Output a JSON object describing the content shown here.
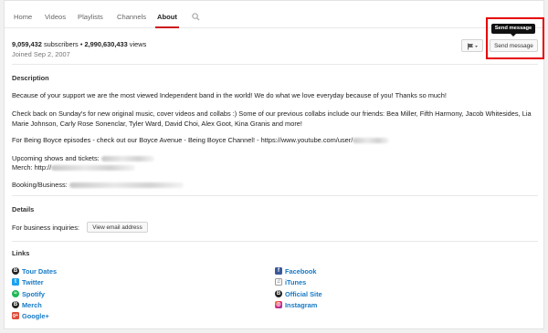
{
  "tabs": [
    {
      "label": "Home"
    },
    {
      "label": "Videos"
    },
    {
      "label": "Playlists"
    },
    {
      "label": "Channels"
    },
    {
      "label": "About"
    }
  ],
  "active_tab": "About",
  "stats": {
    "subscribers": "9,059,432",
    "subscribers_suffix": "subscribers",
    "separator": "•",
    "views": "2,990,630,433",
    "views_suffix": "views",
    "joined": "Joined Sep 2, 2007"
  },
  "actions": {
    "send_message_label": "Send message",
    "tooltip": "Send message"
  },
  "description": {
    "title": "Description",
    "p1": "Because of your support we are the most viewed Independent band in the world! We do what we love everyday because of you! Thanks so much!",
    "p2": "Check back on Sunday's for new original music, cover videos and collabs :) Some of our previous collabs include our friends: Bea Miller, Fifth Harmony, Jacob Whitesides, Lia Marie Johnson, Carly Rose Sonenclar, Tyler Ward, David Choi, Alex Goot, Kina Granis and more!",
    "p3": "For Being Boyce episodes - check out our Boyce Avenue - Being Boyce Channel! - https://www.youtube.com/user/",
    "p4a": "Upcoming shows and tickets: ",
    "p4b": "Merch: http://",
    "p5": "Booking/Business: "
  },
  "details": {
    "title": "Details",
    "business_label": "For business inquiries:",
    "email_button": "View email address"
  },
  "links": {
    "title": "Links",
    "left": [
      {
        "label": "Tour Dates",
        "icon": "channel-logo-icon",
        "color": "#222222"
      },
      {
        "label": "Twitter",
        "icon": "twitter-icon",
        "color": "#1da1f2"
      },
      {
        "label": "Spotify",
        "icon": "spotify-icon",
        "color": "#1db954"
      },
      {
        "label": "Merch",
        "icon": "channel-logo-icon",
        "color": "#222222"
      },
      {
        "label": "Google+",
        "icon": "google-plus-icon",
        "color": "#dd4b39"
      }
    ],
    "right": [
      {
        "label": "Facebook",
        "icon": "facebook-icon",
        "color": "#3b5998"
      },
      {
        "label": "iTunes",
        "icon": "itunes-icon",
        "color": "#8e8e8e"
      },
      {
        "label": "Official Site",
        "icon": "channel-logo-icon",
        "color": "#222222"
      },
      {
        "label": "Instagram",
        "icon": "instagram-icon",
        "color": "#c13584"
      }
    ]
  },
  "colors": {
    "accent": "#cc181e",
    "link": "#167ac6",
    "highlight": "#e60000"
  }
}
